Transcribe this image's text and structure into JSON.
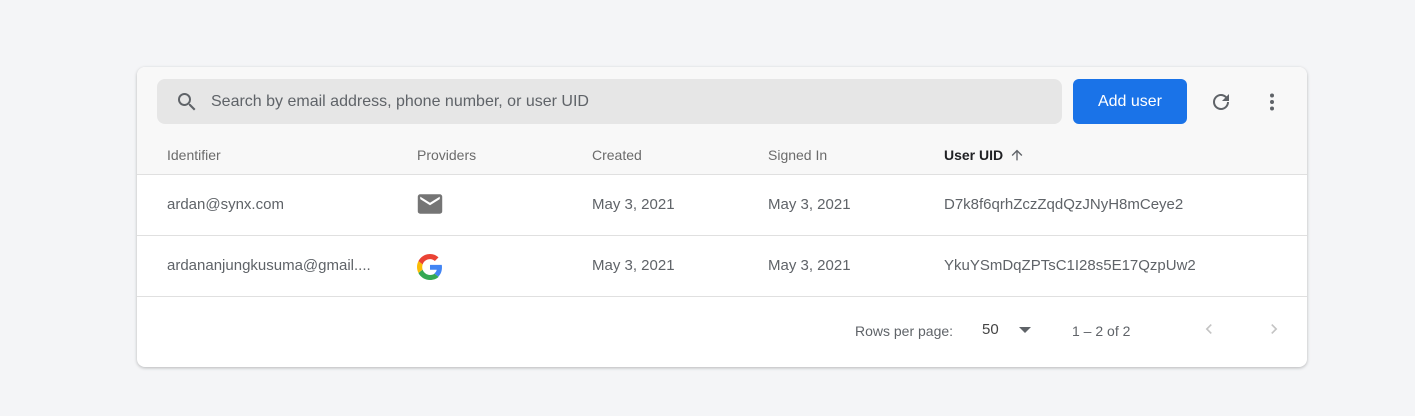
{
  "toolbar": {
    "search_placeholder": "Search by email address, phone number, or user UID",
    "add_user_label": "Add user",
    "icons": [
      "search-icon",
      "refresh-icon",
      "more-vert-icon"
    ]
  },
  "accent": "#1a73e8",
  "table": {
    "headers": [
      "Identifier",
      "Providers",
      "Created",
      "Signed In",
      "User UID"
    ],
    "sort": {
      "column": "User UID",
      "direction": "ascending"
    },
    "rows": [
      {
        "identifier": "ardan@synx.com",
        "provider": "email-icon",
        "created": "May 3, 2021",
        "signed_in": "May 3, 2021",
        "uid": "D7k8f6qrhZczZqdQzJNyH8mCeye2"
      },
      {
        "identifier": "ardananjungkusuma@gmail....",
        "provider": "google-icon",
        "created": "May 3, 2021",
        "signed_in": "May 3, 2021",
        "uid": "YkuYSmDqZPTsC1I28s5E17QzpUw2"
      }
    ]
  },
  "pagination": {
    "rows_per_page_label": "Rows per page:",
    "rows_per_page": "50",
    "range": "1 – 2 of 2"
  }
}
